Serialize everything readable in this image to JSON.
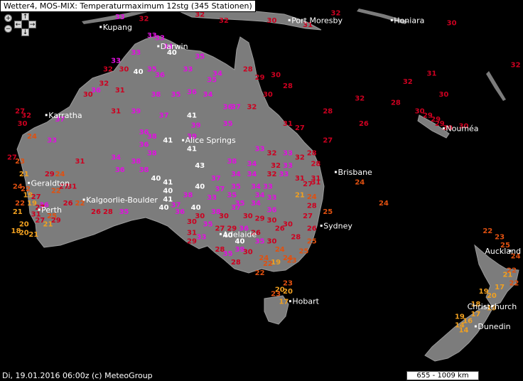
{
  "header": {
    "title": "Wetter4, MOS-MIX: Temperaturmaximum 12stg (345 Stationen)"
  },
  "footer": {
    "timestamp": "Di, 19.01.2016 06:00z (c) MeteoGroup",
    "scale": "655 - 1009 km"
  },
  "controls": {
    "zoom_in": "+",
    "zoom_out": "−",
    "pan_up": "↑",
    "pan_down": "↓",
    "pan_left": "←",
    "pan_right": "→",
    "icons": [
      "zoom-in-icon",
      "zoom-out-icon",
      "arrow-up-icon",
      "arrow-down-icon",
      "arrow-left-icon",
      "arrow-right-icon"
    ]
  },
  "colors": {
    "background": "#000000",
    "land": "#7a7a7a",
    "t_low": "#f0a020",
    "t_mid": "#e05010",
    "t_warm": "#cc0020",
    "t_hot": "#e010e0",
    "t_extreme": "#ffffff"
  },
  "places": [
    {
      "name": "Port Moresby",
      "lon": 147.2,
      "lat": -9.4
    },
    {
      "name": "Honiara",
      "lon": 160.0,
      "lat": -9.4
    },
    {
      "name": "Kupang",
      "lon": 123.6,
      "lat": -10.2
    },
    {
      "name": "Darwin",
      "lon": 130.8,
      "lat": -12.5
    },
    {
      "name": "Karratha",
      "lon": 116.8,
      "lat": -20.7
    },
    {
      "name": "Nouméa",
      "lon": 166.5,
      "lat": -22.3
    },
    {
      "name": "Alice Springs",
      "lon": 133.9,
      "lat": -23.7
    },
    {
      "name": "Brisbane",
      "lon": 153.0,
      "lat": -27.5
    },
    {
      "name": "Geraldton",
      "lon": 114.6,
      "lat": -28.8
    },
    {
      "name": "Kalgoorlie-Boulder",
      "lon": 121.5,
      "lat": -30.8
    },
    {
      "name": "Perth",
      "lon": 115.9,
      "lat": -32.0
    },
    {
      "name": "Sydney",
      "lon": 151.2,
      "lat": -33.9
    },
    {
      "name": "Adelaide",
      "lon": 138.6,
      "lat": -34.9
    },
    {
      "name": "Auckland",
      "lon": 174.8,
      "lat": -36.9
    },
    {
      "name": "Hobart",
      "lon": 147.3,
      "lat": -42.9
    },
    {
      "name": "Christchurch",
      "lon": 172.6,
      "lat": -43.5
    },
    {
      "name": "Dunedin",
      "lon": 170.5,
      "lat": -45.9
    }
  ],
  "stations": [
    {
      "t": 33,
      "lon": 126.0,
      "lat": -9.3
    },
    {
      "t": 32,
      "lon": 129.0,
      "lat": -9.5
    },
    {
      "t": 32,
      "lon": 139.0,
      "lat": -9.7
    },
    {
      "t": 30,
      "lon": 145.0,
      "lat": -9.7
    },
    {
      "t": 31,
      "lon": 149.5,
      "lat": -10.2
    },
    {
      "t": 32,
      "lon": 153.0,
      "lat": -8.8
    },
    {
      "t": 30,
      "lon": 167.5,
      "lat": -10.0
    },
    {
      "t": 31,
      "lon": 178.0,
      "lat": -11.8
    },
    {
      "t": 32,
      "lon": 136.0,
      "lat": -9.0
    },
    {
      "t": 33,
      "lon": 130.0,
      "lat": -11.5
    },
    {
      "t": 33,
      "lon": 131.0,
      "lat": -11.8
    },
    {
      "t": 34,
      "lon": 132.0,
      "lat": -12.8
    },
    {
      "t": 40,
      "lon": 132.5,
      "lat": -13.5
    },
    {
      "t": 33,
      "lon": 128.0,
      "lat": -13.5
    },
    {
      "t": 33,
      "lon": 125.5,
      "lat": -14.5
    },
    {
      "t": 32,
      "lon": 124.5,
      "lat": -15.5
    },
    {
      "t": 30,
      "lon": 126.5,
      "lat": -15.5
    },
    {
      "t": 40,
      "lon": 128.3,
      "lat": -15.8
    },
    {
      "t": 35,
      "lon": 130.0,
      "lat": -15.5
    },
    {
      "t": 36,
      "lon": 131.0,
      "lat": -16.2
    },
    {
      "t": 33,
      "lon": 134.5,
      "lat": -15.5
    },
    {
      "t": 35,
      "lon": 136.0,
      "lat": -14.0
    },
    {
      "t": 34,
      "lon": 138.2,
      "lat": -16.0
    },
    {
      "t": 35,
      "lon": 137.5,
      "lat": -16.8
    },
    {
      "t": 28,
      "lon": 142.0,
      "lat": -15.5
    },
    {
      "t": 29,
      "lon": 143.5,
      "lat": -16.5
    },
    {
      "t": 30,
      "lon": 145.5,
      "lat": -16.2
    },
    {
      "t": 28,
      "lon": 147.0,
      "lat": -17.5
    },
    {
      "t": 32,
      "lon": 156.0,
      "lat": -19.0
    },
    {
      "t": 28,
      "lon": 152.0,
      "lat": -20.5
    },
    {
      "t": 26,
      "lon": 156.5,
      "lat": -22.0
    },
    {
      "t": 31,
      "lon": 126.0,
      "lat": -18.0
    },
    {
      "t": 36,
      "lon": 123.0,
      "lat": -18.0
    },
    {
      "t": 32,
      "lon": 124.0,
      "lat": -17.2
    },
    {
      "t": 30,
      "lon": 122.0,
      "lat": -18.5
    },
    {
      "t": 38,
      "lon": 130.5,
      "lat": -18.5
    },
    {
      "t": 35,
      "lon": 133.0,
      "lat": -18.5
    },
    {
      "t": 36,
      "lon": 135.0,
      "lat": -18.2
    },
    {
      "t": 34,
      "lon": 137.0,
      "lat": -18.5
    },
    {
      "t": 36,
      "lon": 139.5,
      "lat": -20.0
    },
    {
      "t": 37,
      "lon": 140.5,
      "lat": -20.0
    },
    {
      "t": 32,
      "lon": 142.5,
      "lat": -20.0
    },
    {
      "t": 30,
      "lon": 144.5,
      "lat": -18.5
    },
    {
      "t": 27,
      "lon": 113.5,
      "lat": -20.5
    },
    {
      "t": 32,
      "lon": 114.3,
      "lat": -21.0
    },
    {
      "t": 30,
      "lon": 113.8,
      "lat": -22.0
    },
    {
      "t": 37,
      "lon": 118.5,
      "lat": -21.5
    },
    {
      "t": 31,
      "lon": 125.5,
      "lat": -20.5
    },
    {
      "t": 39,
      "lon": 128.0,
      "lat": -20.5
    },
    {
      "t": 37,
      "lon": 131.5,
      "lat": -21.0
    },
    {
      "t": 41,
      "lon": 135.0,
      "lat": -21.0
    },
    {
      "t": 39,
      "lon": 135.5,
      "lat": -22.2
    },
    {
      "t": 35,
      "lon": 139.5,
      "lat": -22.0
    },
    {
      "t": 31,
      "lon": 147.0,
      "lat": -22.0
    },
    {
      "t": 27,
      "lon": 148.5,
      "lat": -22.5
    },
    {
      "t": 24,
      "lon": 115.0,
      "lat": -23.5
    },
    {
      "t": 33,
      "lon": 117.5,
      "lat": -24.0
    },
    {
      "t": 36,
      "lon": 129.0,
      "lat": -23.0
    },
    {
      "t": 38,
      "lon": 130.0,
      "lat": -23.5
    },
    {
      "t": 41,
      "lon": 132.0,
      "lat": -24.0
    },
    {
      "t": 39,
      "lon": 135.0,
      "lat": -23.5
    },
    {
      "t": 41,
      "lon": 135.0,
      "lat": -25.0
    },
    {
      "t": 36,
      "lon": 129.0,
      "lat": -24.5
    },
    {
      "t": 38,
      "lon": 130.0,
      "lat": -25.5
    },
    {
      "t": 33,
      "lon": 143.5,
      "lat": -25.0
    },
    {
      "t": 32,
      "lon": 145.0,
      "lat": -25.5
    },
    {
      "t": 33,
      "lon": 147.0,
      "lat": -25.5
    },
    {
      "t": 32,
      "lon": 148.5,
      "lat": -26.0
    },
    {
      "t": 28,
      "lon": 150.0,
      "lat": -25.5
    },
    {
      "t": 27,
      "lon": 152.0,
      "lat": -24.0
    },
    {
      "t": 27,
      "lon": 112.5,
      "lat": -26.0
    },
    {
      "t": 23,
      "lon": 113.5,
      "lat": -26.5
    },
    {
      "t": 31,
      "lon": 121.0,
      "lat": -26.5
    },
    {
      "t": 34,
      "lon": 125.5,
      "lat": -26.0
    },
    {
      "t": 38,
      "lon": 128.0,
      "lat": -26.5
    },
    {
      "t": 43,
      "lon": 136.0,
      "lat": -27.0
    },
    {
      "t": 38,
      "lon": 140.0,
      "lat": -26.5
    },
    {
      "t": 34,
      "lon": 142.5,
      "lat": -26.8
    },
    {
      "t": 32,
      "lon": 145.5,
      "lat": -27.0
    },
    {
      "t": 33,
      "lon": 147.0,
      "lat": -27.0
    },
    {
      "t": 28,
      "lon": 150.5,
      "lat": -26.8
    },
    {
      "t": 21,
      "lon": 114.0,
      "lat": -28.0
    },
    {
      "t": 29,
      "lon": 117.2,
      "lat": -28.0
    },
    {
      "t": 24,
      "lon": 118.5,
      "lat": -28.0
    },
    {
      "t": 36,
      "lon": 126.0,
      "lat": -27.5
    },
    {
      "t": 38,
      "lon": 129.0,
      "lat": -27.5
    },
    {
      "t": 40,
      "lon": 130.5,
      "lat": -28.5
    },
    {
      "t": 41,
      "lon": 132.0,
      "lat": -29.0
    },
    {
      "t": 40,
      "lon": 136.0,
      "lat": -29.5
    },
    {
      "t": 37,
      "lon": 138.0,
      "lat": -28.5
    },
    {
      "t": 34,
      "lon": 140.5,
      "lat": -28.0
    },
    {
      "t": 34,
      "lon": 142.5,
      "lat": -28.0
    },
    {
      "t": 32,
      "lon": 145.0,
      "lat": -28.0
    },
    {
      "t": 33,
      "lon": 146.5,
      "lat": -28.0
    },
    {
      "t": 31,
      "lon": 148.5,
      "lat": -28.5
    },
    {
      "t": 31,
      "lon": 150.5,
      "lat": -28.5
    },
    {
      "t": 24,
      "lon": 113.2,
      "lat": -29.5
    },
    {
      "t": 22,
      "lon": 114.2,
      "lat": -29.8
    },
    {
      "t": 22,
      "lon": 118.0,
      "lat": -30.0
    },
    {
      "t": 27,
      "lon": 119.0,
      "lat": -29.5
    },
    {
      "t": 31,
      "lon": 120.0,
      "lat": -29.5
    },
    {
      "t": 40,
      "lon": 132.0,
      "lat": -30.0
    },
    {
      "t": 37,
      "lon": 138.5,
      "lat": -29.8
    },
    {
      "t": 35,
      "lon": 140.5,
      "lat": -29.5
    },
    {
      "t": 34,
      "lon": 143.0,
      "lat": -29.5
    },
    {
      "t": 33,
      "lon": 144.5,
      "lat": -29.5
    },
    {
      "t": 27,
      "lon": 149.5,
      "lat": -29.2
    },
    {
      "t": 31,
      "lon": 150.5,
      "lat": -29.0
    },
    {
      "t": 19,
      "lon": 114.5,
      "lat": -30.5
    },
    {
      "t": 22,
      "lon": 113.5,
      "lat": -31.5
    },
    {
      "t": 19,
      "lon": 115.0,
      "lat": -31.5
    },
    {
      "t": 27,
      "lon": 115.5,
      "lat": -30.7
    },
    {
      "t": 38,
      "lon": 134.5,
      "lat": -30.5
    },
    {
      "t": 33,
      "lon": 137.5,
      "lat": -30.8
    },
    {
      "t": 35,
      "lon": 140.0,
      "lat": -30.5
    },
    {
      "t": 35,
      "lon": 141.0,
      "lat": -31.5
    },
    {
      "t": 34,
      "lon": 143.5,
      "lat": -30.5
    },
    {
      "t": 33,
      "lon": 145.0,
      "lat": -30.8
    },
    {
      "t": 21,
      "lon": 148.5,
      "lat": -30.5
    },
    {
      "t": 24,
      "lon": 150.0,
      "lat": -30.7
    },
    {
      "t": 24,
      "lon": 156.0,
      "lat": -29.0
    },
    {
      "t": 24,
      "lon": 159.0,
      "lat": -31.5
    },
    {
      "t": 36,
      "lon": 116.5,
      "lat": -31.7
    },
    {
      "t": 26,
      "lon": 119.5,
      "lat": -31.5
    },
    {
      "t": 22,
      "lon": 121.0,
      "lat": -31.5
    },
    {
      "t": 41,
      "lon": 132.0,
      "lat": -31.0
    },
    {
      "t": 40,
      "lon": 131.5,
      "lat": -32.0
    },
    {
      "t": 37,
      "lon": 133.0,
      "lat": -31.7
    },
    {
      "t": 40,
      "lon": 135.5,
      "lat": -32.0
    },
    {
      "t": 38,
      "lon": 138.0,
      "lat": -32.5
    },
    {
      "t": 37,
      "lon": 140.5,
      "lat": -32.0
    },
    {
      "t": 34,
      "lon": 143.0,
      "lat": -31.5
    },
    {
      "t": 36,
      "lon": 145.0,
      "lat": -32.3
    },
    {
      "t": 28,
      "lon": 150.0,
      "lat": -31.8
    },
    {
      "t": 25,
      "lon": 152.0,
      "lat": -32.5
    },
    {
      "t": 21,
      "lon": 113.2,
      "lat": -32.5
    },
    {
      "t": 27,
      "lon": 116.0,
      "lat": -32.0
    },
    {
      "t": 31,
      "lon": 115.5,
      "lat": -32.8
    },
    {
      "t": 25,
      "lon": 117.5,
      "lat": -33.0
    },
    {
      "t": 26,
      "lon": 123.0,
      "lat": -32.5
    },
    {
      "t": 28,
      "lon": 124.5,
      "lat": -32.5
    },
    {
      "t": 35,
      "lon": 126.5,
      "lat": -32.5
    },
    {
      "t": 30,
      "lon": 136.0,
      "lat": -33.0
    },
    {
      "t": 30,
      "lon": 139.0,
      "lat": -33.0
    },
    {
      "t": 30,
      "lon": 142.0,
      "lat": -33.0
    },
    {
      "t": 29,
      "lon": 143.5,
      "lat": -33.3
    },
    {
      "t": 30,
      "lon": 145.0,
      "lat": -33.5
    },
    {
      "t": 27,
      "lon": 149.5,
      "lat": -33.0
    },
    {
      "t": 20,
      "lon": 114.0,
      "lat": -34.0
    },
    {
      "t": 27,
      "lon": 116.0,
      "lat": -33.5
    },
    {
      "t": 21,
      "lon": 117.0,
      "lat": -34.0
    },
    {
      "t": 29,
      "lon": 118.0,
      "lat": -33.5
    },
    {
      "t": 18,
      "lon": 113.0,
      "lat": -34.8
    },
    {
      "t": 20,
      "lon": 114.0,
      "lat": -35.0
    },
    {
      "t": 21,
      "lon": 115.2,
      "lat": -35.2
    },
    {
      "t": 36,
      "lon": 133.5,
      "lat": -32.5
    },
    {
      "t": 30,
      "lon": 135.0,
      "lat": -33.7
    },
    {
      "t": 35,
      "lon": 137.0,
      "lat": -34.0
    },
    {
      "t": 27,
      "lon": 138.5,
      "lat": -34.5
    },
    {
      "t": 29,
      "lon": 140.0,
      "lat": -34.5
    },
    {
      "t": 36,
      "lon": 141.5,
      "lat": -34.5
    },
    {
      "t": 26,
      "lon": 143.0,
      "lat": -35.0
    },
    {
      "t": 26,
      "lon": 146.0,
      "lat": -34.5
    },
    {
      "t": 30,
      "lon": 147.0,
      "lat": -34.0
    },
    {
      "t": 26,
      "lon": 150.0,
      "lat": -34.5
    },
    {
      "t": 31,
      "lon": 135.0,
      "lat": -35.0
    },
    {
      "t": 33,
      "lon": 136.2,
      "lat": -35.5
    },
    {
      "t": 29,
      "lon": 135.0,
      "lat": -36.0
    },
    {
      "t": 40,
      "lon": 139.5,
      "lat": -35.3
    },
    {
      "t": 40,
      "lon": 141.0,
      "lat": -36.0
    },
    {
      "t": 35,
      "lon": 143.5,
      "lat": -36.0
    },
    {
      "t": 30,
      "lon": 145.0,
      "lat": -36.0
    },
    {
      "t": 28,
      "lon": 148.0,
      "lat": -35.5
    },
    {
      "t": 25,
      "lon": 150.0,
      "lat": -36.0
    },
    {
      "t": 28,
      "lon": 138.5,
      "lat": -37.0
    },
    {
      "t": 35,
      "lon": 139.5,
      "lat": -37.5
    },
    {
      "t": 39,
      "lon": 141.0,
      "lat": -37.0
    },
    {
      "t": 30,
      "lon": 142.0,
      "lat": -37.3
    },
    {
      "t": 24,
      "lon": 146.0,
      "lat": -37.0
    },
    {
      "t": 25,
      "lon": 149.0,
      "lat": -37.2
    },
    {
      "t": 24,
      "lon": 144.0,
      "lat": -38.0
    },
    {
      "t": 22,
      "lon": 144.5,
      "lat": -38.7
    },
    {
      "t": 19,
      "lon": 145.5,
      "lat": -38.5
    },
    {
      "t": 24,
      "lon": 147.0,
      "lat": -38.0
    },
    {
      "t": 23,
      "lon": 147.5,
      "lat": -38.3
    },
    {
      "t": 28,
      "lon": 140.5,
      "lat": -38.5
    },
    {
      "t": 22,
      "lon": 143.5,
      "lat": -39.8
    },
    {
      "t": 23,
      "lon": 147.0,
      "lat": -41.0
    },
    {
      "t": 20,
      "lon": 146.0,
      "lat": -41.8
    },
    {
      "t": 23,
      "lon": 145.5,
      "lat": -42.3
    },
    {
      "t": 20,
      "lon": 147.0,
      "lat": -42.0
    },
    {
      "t": 17,
      "lon": 146.5,
      "lat": -43.2
    },
    {
      "t": 22,
      "lon": 172.0,
      "lat": -34.8
    },
    {
      "t": 23,
      "lon": 173.5,
      "lat": -35.5
    },
    {
      "t": 25,
      "lon": 174.2,
      "lat": -36.5
    },
    {
      "t": 24,
      "lon": 175.5,
      "lat": -37.8
    },
    {
      "t": 28,
      "lon": 176.5,
      "lat": -38.5
    },
    {
      "t": 22,
      "lon": 175.0,
      "lat": -39.5
    },
    {
      "t": 21,
      "lon": 174.5,
      "lat": -40.0
    },
    {
      "t": 22,
      "lon": 175.3,
      "lat": -41.0
    },
    {
      "t": 19,
      "lon": 171.5,
      "lat": -42.0
    },
    {
      "t": 20,
      "lon": 172.5,
      "lat": -42.5
    },
    {
      "t": 17,
      "lon": 173.5,
      "lat": -41.5
    },
    {
      "t": 18,
      "lon": 170.5,
      "lat": -43.5
    },
    {
      "t": 19,
      "lon": 172.5,
      "lat": -44.0
    },
    {
      "t": 19,
      "lon": 168.5,
      "lat": -45.0
    },
    {
      "t": 17,
      "lon": 170.5,
      "lat": -44.7
    },
    {
      "t": 16,
      "lon": 169.5,
      "lat": -45.5
    },
    {
      "t": 14,
      "lon": 168.5,
      "lat": -46.0
    },
    {
      "t": 14,
      "lon": 169.0,
      "lat": -46.6
    },
    {
      "t": 30,
      "lon": 163.5,
      "lat": -20.5
    },
    {
      "t": 29,
      "lon": 164.5,
      "lat": -21.0
    },
    {
      "t": 29,
      "lon": 165.5,
      "lat": -21.5
    },
    {
      "t": 29,
      "lon": 166.0,
      "lat": -22.0
    },
    {
      "t": 30,
      "lon": 167.0,
      "lat": -22.5
    },
    {
      "t": 30,
      "lon": 169.0,
      "lat": -22.3
    },
    {
      "t": 28,
      "lon": 160.5,
      "lat": -19.5
    },
    {
      "t": 32,
      "lon": 162.0,
      "lat": -17.0
    },
    {
      "t": 31,
      "lon": 165.0,
      "lat": -16.0
    },
    {
      "t": 30,
      "lon": 166.5,
      "lat": -18.5
    },
    {
      "t": 32,
      "lon": 175.5,
      "lat": -15.0
    },
    {
      "t": 31,
      "lon": 176.5,
      "lat": -16.5
    }
  ]
}
